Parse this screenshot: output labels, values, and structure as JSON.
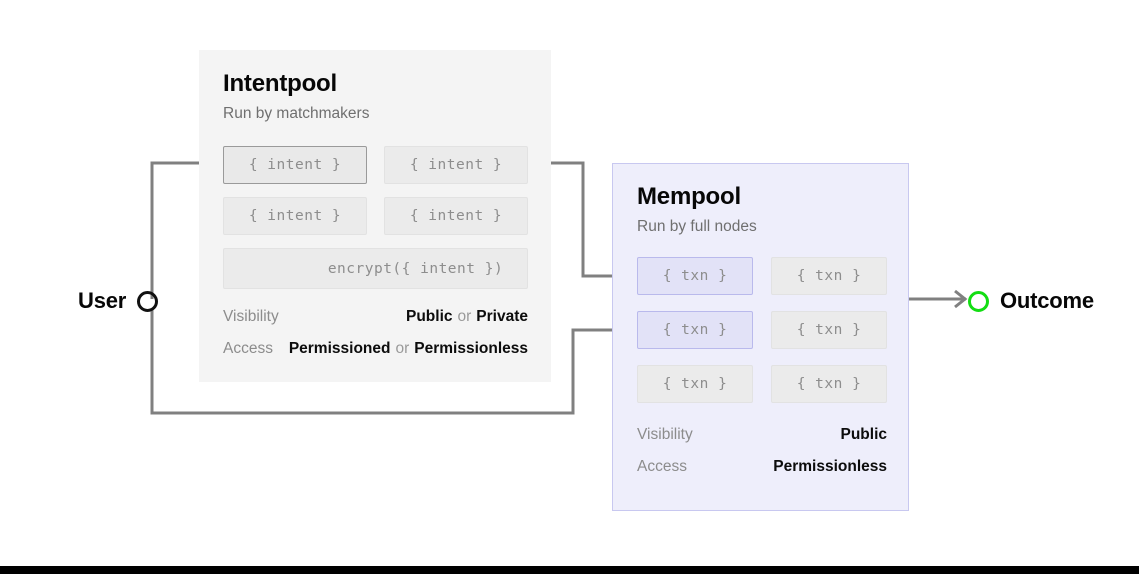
{
  "diagram": {
    "title_hidden": "",
    "colors": {
      "intentpool_bg": "#f4f4f4",
      "mempool_bg": "#eeeefb",
      "mempool_border": "#c8c8f0",
      "chip_lavender_bg": "#e2e2f7",
      "chip_lavender_border": "#b9b9ec",
      "chip_gray_bg": "#ebebeb",
      "chip_gray_border": "#e2e2e2",
      "chip_active_border": "#9a9a9a",
      "wire": "#808080",
      "outcome_green": "#13dd13",
      "user_black": "#111111"
    }
  },
  "user": {
    "label": "User",
    "marker": "hollow-circle-black"
  },
  "outcome": {
    "label": "Outcome",
    "marker": "hollow-circle-green"
  },
  "intentpool": {
    "title": "Intentpool",
    "subtitle": "Run by matchmakers",
    "items": [
      {
        "text": "{ intent }",
        "style": "highlight-gray"
      },
      {
        "text": "{ intent }",
        "style": "plain"
      },
      {
        "text": "{ intent }",
        "style": "plain"
      },
      {
        "text": "{ intent }",
        "style": "plain"
      }
    ],
    "encrypted_item": {
      "text": "encrypt({ intent })",
      "style": "plain"
    },
    "attributes": [
      {
        "label": "Visibility",
        "values": [
          "Public",
          "Private"
        ],
        "separator": "or"
      },
      {
        "label": "Access",
        "values": [
          "Permissioned",
          "Permissionless"
        ],
        "separator": "or"
      }
    ]
  },
  "mempool": {
    "title": "Mempool",
    "subtitle": "Run by full nodes",
    "items": [
      {
        "text": "{ txn }",
        "style": "lavender"
      },
      {
        "text": "{ txn }",
        "style": "plain"
      },
      {
        "text": "{ txn }",
        "style": "lavender"
      },
      {
        "text": "{ txn }",
        "style": "plain"
      },
      {
        "text": "{ txn }",
        "style": "plain"
      },
      {
        "text": "{ txn }",
        "style": "plain"
      }
    ],
    "attributes": [
      {
        "label": "Visibility",
        "values": [
          "Public"
        ],
        "separator": ""
      },
      {
        "label": "Access",
        "values": [
          "Permissionless"
        ],
        "separator": ""
      }
    ]
  },
  "connectors": [
    {
      "name": "user-to-intentpool",
      "from": "User",
      "to": "{ intent }"
    },
    {
      "name": "intentpool-to-mempool",
      "from": "{ intent }",
      "to": "{ txn }"
    },
    {
      "name": "user-to-mempool-direct",
      "from": "User",
      "to": "{ txn }"
    },
    {
      "name": "mempool-to-outcome",
      "from": "Mempool",
      "to": "Outcome"
    }
  ]
}
